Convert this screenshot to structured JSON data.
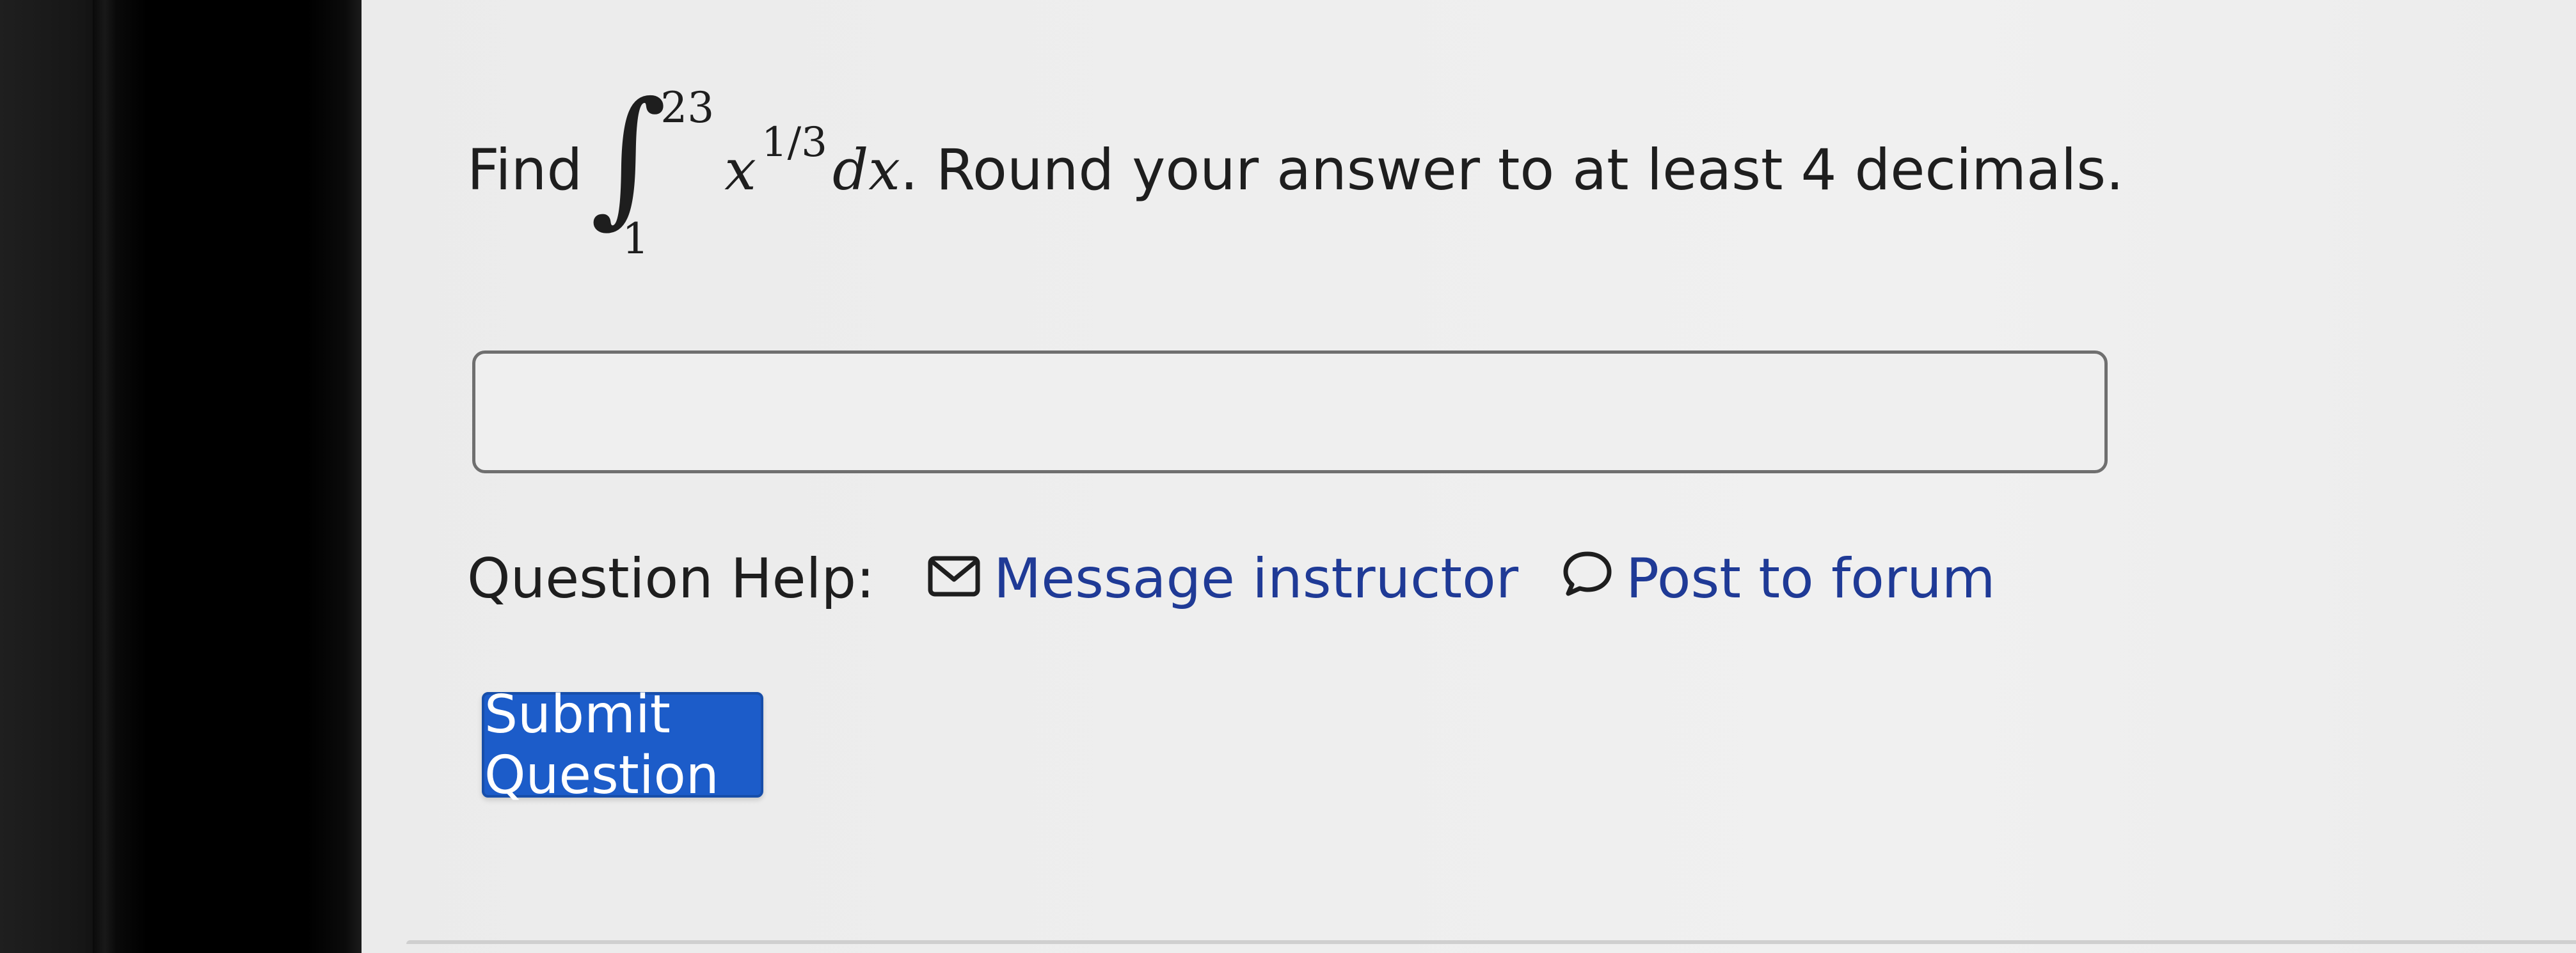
{
  "question": {
    "find_label": "Find",
    "integral_sign": "∫",
    "upper_limit": "23",
    "lower_limit": "1",
    "integrand_base": "x",
    "integrand_exponent": "1/3",
    "differential": "dx",
    "instruction": ". Round your answer to at least 4 decimals."
  },
  "answer": {
    "value": "",
    "placeholder": ""
  },
  "help": {
    "label": "Question Help:",
    "message_link": "Message instructor",
    "message_icon": "envelope-icon",
    "forum_link": "Post to forum",
    "forum_icon": "speech-bubble-icon"
  },
  "submit": {
    "label": "Submit Question",
    "color": "#1c5cc9"
  },
  "colors": {
    "link": "#1f3a96",
    "text": "#1e1e1e",
    "background": "#eeeeee"
  }
}
